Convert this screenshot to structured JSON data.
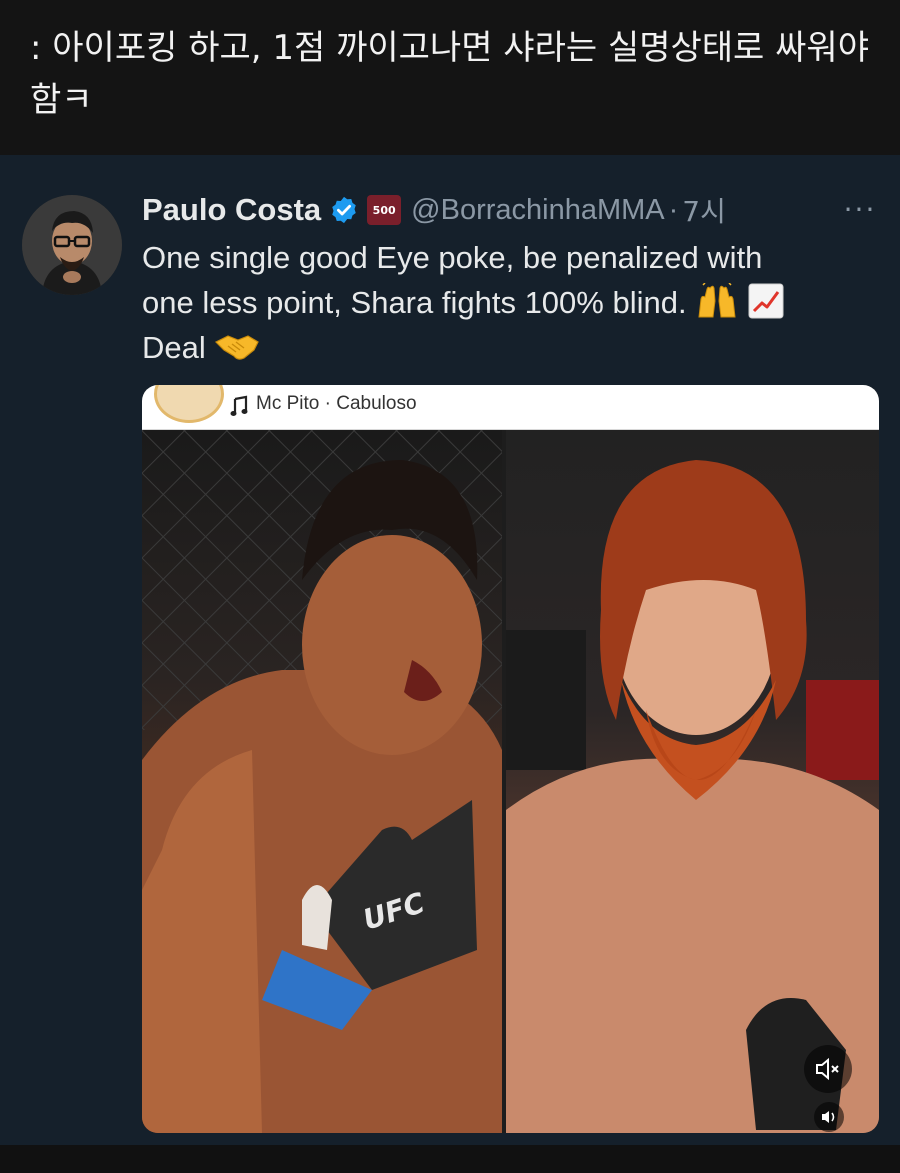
{
  "caption": {
    "text": ": 아이포킹 하고, 1점 까이고나면 샤라는 실명상태로 싸워야 함ㅋ"
  },
  "tweet": {
    "display_name": "Paulo Costa",
    "badge_text": "500",
    "handle": "@BorrachinhaMMA",
    "separator": "·",
    "time": "7시",
    "more_label": "···",
    "text_lines": [
      "One single good Eye poke, be penalized with",
      "one less point, Shara fights 100% blind.",
      "Deal"
    ],
    "emojis": [
      "raising-hands",
      "chart-increasing",
      "handshake"
    ]
  },
  "media": {
    "music_label": "Mc Pito · Cabuloso",
    "glove_text": "UFC"
  },
  "colors": {
    "background": "#15202b",
    "text": "#e7e9ea",
    "muted": "#8b98a5",
    "verified": "#1d9bf0"
  }
}
